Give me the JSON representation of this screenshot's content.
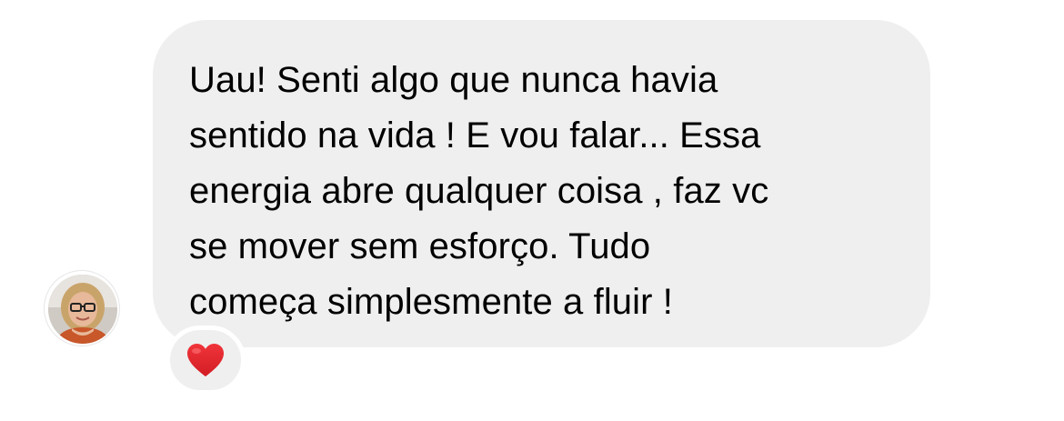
{
  "message": {
    "text": "Uau! Senti algo que nunca havia\nsentido na vida ! E vou falar... Essa\nenergia abre qualquer coisa , faz vc\nse mover sem esforço. Tudo\ncomeça simplesmente a fluir !"
  },
  "sender": {
    "avatar_icon": "profile-photo"
  },
  "reaction": {
    "icon": "red-heart-icon",
    "color": "#e0242a"
  },
  "colors": {
    "bubble": "#efefef",
    "text": "#000000",
    "background": "#ffffff"
  }
}
